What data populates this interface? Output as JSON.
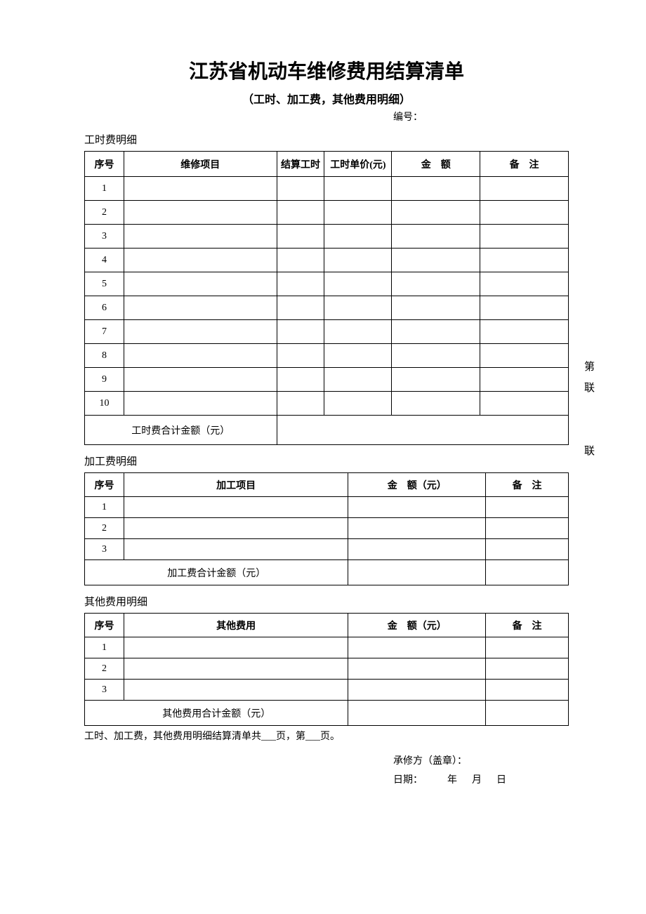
{
  "header": {
    "title": "江苏省机动车维修费用结算清单",
    "subtitle": "（工时、加工费，其他费用明细）",
    "docnum_label": "编号："
  },
  "section1": {
    "label": "工时费明细",
    "headers": {
      "seq": "序号",
      "item": "维修项目",
      "hours": "结算工时",
      "unit_price": "工时单价(元)",
      "amount": "金　额",
      "note": "备　注"
    },
    "rows": [
      {
        "seq": "1",
        "item": "",
        "hours": "",
        "unit_price": "",
        "amount": "",
        "note": ""
      },
      {
        "seq": "2",
        "item": "",
        "hours": "",
        "unit_price": "",
        "amount": "",
        "note": ""
      },
      {
        "seq": "3",
        "item": "",
        "hours": "",
        "unit_price": "",
        "amount": "",
        "note": ""
      },
      {
        "seq": "4",
        "item": "",
        "hours": "",
        "unit_price": "",
        "amount": "",
        "note": ""
      },
      {
        "seq": "5",
        "item": "",
        "hours": "",
        "unit_price": "",
        "amount": "",
        "note": ""
      },
      {
        "seq": "6",
        "item": "",
        "hours": "",
        "unit_price": "",
        "amount": "",
        "note": ""
      },
      {
        "seq": "7",
        "item": "",
        "hours": "",
        "unit_price": "",
        "amount": "",
        "note": ""
      },
      {
        "seq": "8",
        "item": "",
        "hours": "",
        "unit_price": "",
        "amount": "",
        "note": ""
      },
      {
        "seq": "9",
        "item": "",
        "hours": "",
        "unit_price": "",
        "amount": "",
        "note": ""
      },
      {
        "seq": "10",
        "item": "",
        "hours": "",
        "unit_price": "",
        "amount": "",
        "note": ""
      }
    ],
    "total_label": "工时费合计金额（元）",
    "total_value": ""
  },
  "section2": {
    "label": "加工费明细",
    "headers": {
      "seq": "序号",
      "item": "加工项目",
      "amount": "金　额（元）",
      "note": "备　注"
    },
    "rows": [
      {
        "seq": "1",
        "item": "",
        "amount": "",
        "note": ""
      },
      {
        "seq": "2",
        "item": "",
        "amount": "",
        "note": ""
      },
      {
        "seq": "3",
        "item": "",
        "amount": "",
        "note": ""
      }
    ],
    "total_label": "加工费合计金额（元）",
    "total_value": ""
  },
  "section3": {
    "label": "其他费用明细",
    "headers": {
      "seq": "序号",
      "item": "其他费用",
      "amount": "金　额（元）",
      "note": "备　注"
    },
    "rows": [
      {
        "seq": "1",
        "item": "",
        "amount": "",
        "note": ""
      },
      {
        "seq": "2",
        "item": "",
        "amount": "",
        "note": ""
      },
      {
        "seq": "3",
        "item": "",
        "amount": "",
        "note": ""
      }
    ],
    "total_label": "其他费用合计金额（元）",
    "total_value": ""
  },
  "footer": {
    "page_note": "工时、加工费，其他费用明细结算清单共___页，第___页。",
    "sign_label": "承修方（盖章）：",
    "date_label": "日期：",
    "year": "年",
    "month": "月",
    "day": "日"
  },
  "side": {
    "a1": "第",
    "a2": "联",
    "b1": "联"
  }
}
